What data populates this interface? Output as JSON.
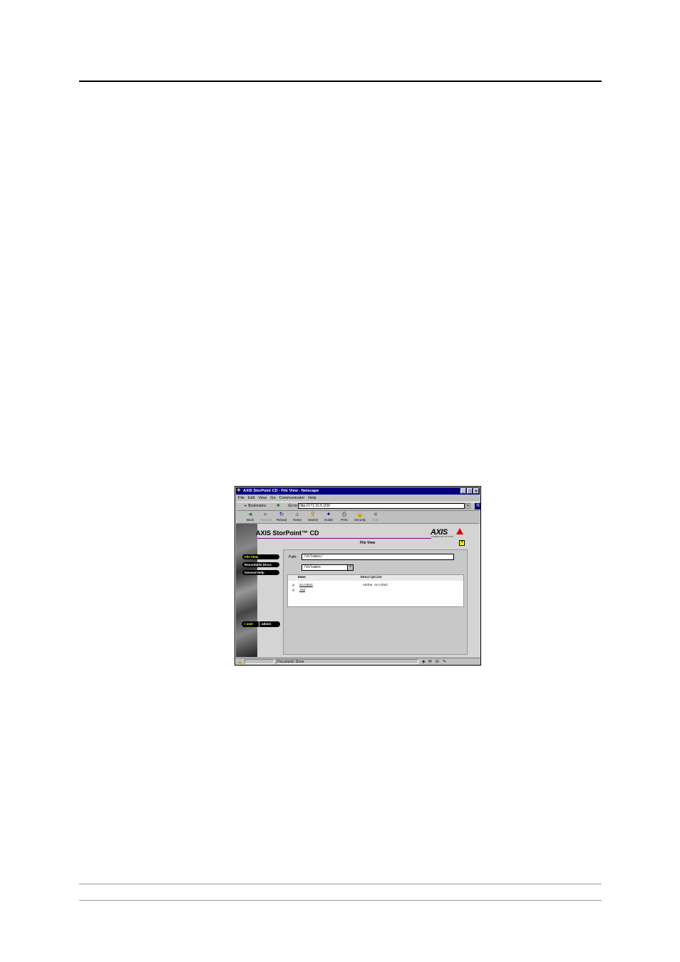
{
  "browser": {
    "title": "AXIS StorPoint CD - File View - Netscape",
    "menu": [
      "File",
      "Edit",
      "View",
      "Go",
      "Communicator",
      "Help"
    ],
    "bookmarks_label": "Bookmarks",
    "goto_label": "Go to:",
    "url": "http://171.16.5.159/",
    "nav": [
      {
        "label": "Back",
        "icon": "back-arrow-icon"
      },
      {
        "label": "Forward",
        "icon": "forward-arrow-icon",
        "disabled": true
      },
      {
        "label": "Reload",
        "icon": "reload-icon"
      },
      {
        "label": "Home",
        "icon": "home-icon"
      },
      {
        "label": "Search",
        "icon": "search-icon"
      },
      {
        "label": "Guide",
        "icon": "guide-icon"
      },
      {
        "label": "Print",
        "icon": "print-icon"
      },
      {
        "label": "Security",
        "icon": "lock-icon"
      },
      {
        "label": "Stop",
        "icon": "stop-icon",
        "disabled": true
      }
    ],
    "status": "Document: Done"
  },
  "page": {
    "product_name": "AXIS StorPoint™ CD",
    "brand": "AXIS",
    "brand_sub": "COMMUNICATIONS",
    "section_title": "File View",
    "help": "?",
    "sidebar": [
      {
        "label": "File View",
        "active": true
      },
      {
        "label": "Recordable Discs",
        "active": false
      },
      {
        "label": "General Help",
        "active": false
      }
    ],
    "user_label": "» user",
    "admin_label": "admin",
    "path_label": "Path:",
    "path_value": "/Volumes/",
    "select_value": "/Volumes",
    "table": {
      "headers": [
        "Name",
        "Description"
      ],
      "rows": [
        {
          "name": "Acrobat",
          "description": "Adobe Acrobat"
        },
        {
          "name": "JAZ",
          "description": ""
        }
      ]
    }
  },
  "colors": {
    "titlebar": "#000080",
    "accent_line": "#800080",
    "axis_red": "#dd0000"
  }
}
